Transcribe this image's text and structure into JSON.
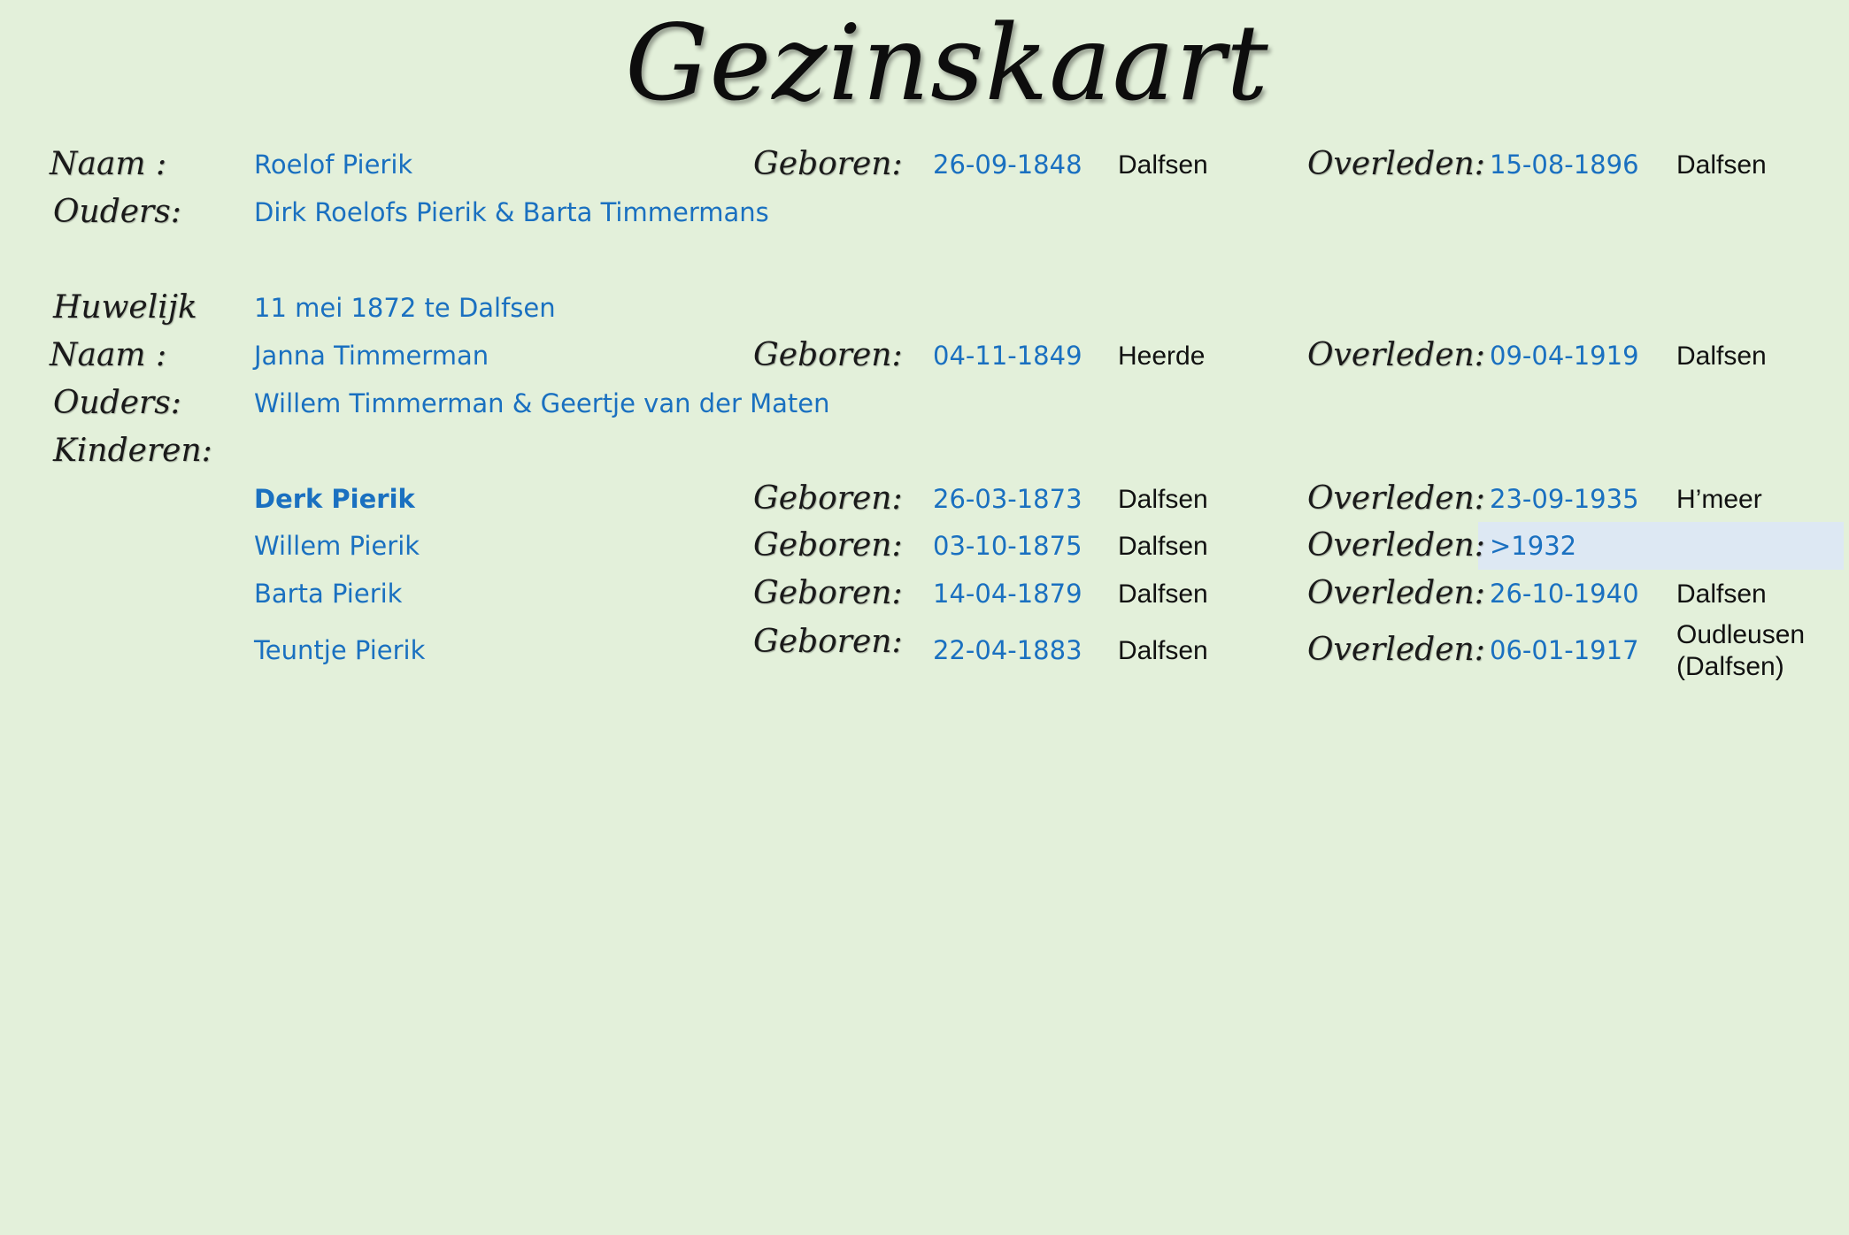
{
  "title": "Gezinskaart",
  "labels": {
    "naam": "Naam :",
    "ouders": "Ouders:",
    "huwelijk": "Huwelijk",
    "kinderen": "Kinderen:",
    "geboren": "Geboren:",
    "overleden": "Overleden:"
  },
  "husband": {
    "name": "Roelof Pierik",
    "born_date": "26-09-1848",
    "born_place": "Dalfsen",
    "died_date": "15-08-1896",
    "died_place": "Dalfsen",
    "parents": "Dirk Roelofs Pierik & Barta Timmermans"
  },
  "marriage": "11 mei 1872 te Dalfsen",
  "wife": {
    "name": "Janna Timmerman",
    "born_date": "04-11-1849",
    "born_place": "Heerde",
    "died_date": "09-04-1919",
    "died_place": "Dalfsen",
    "parents": "Willem Timmerman & Geertje van der Maten"
  },
  "children": [
    {
      "name": "Derk Pierik",
      "born_date": "26-03-1873",
      "born_place": "Dalfsen",
      "died_date": "23-09-1935",
      "died_place": "H’meer"
    },
    {
      "name": "Willem Pierik",
      "born_date": "03-10-1875",
      "born_place": "Dalfsen",
      "died_date": ">1932",
      "died_place": ""
    },
    {
      "name": "Barta Pierik",
      "born_date": "14-04-1879",
      "born_place": "Dalfsen",
      "died_date": "26-10-1940",
      "died_place": "Dalfsen"
    },
    {
      "name": "Teuntje Pierik",
      "born_date": "22-04-1883",
      "born_place": "Dalfsen",
      "died_date": "06-01-1917",
      "died_place_line1": "Oudleusen",
      "died_place_line2": "(Dalfsen)"
    }
  ]
}
